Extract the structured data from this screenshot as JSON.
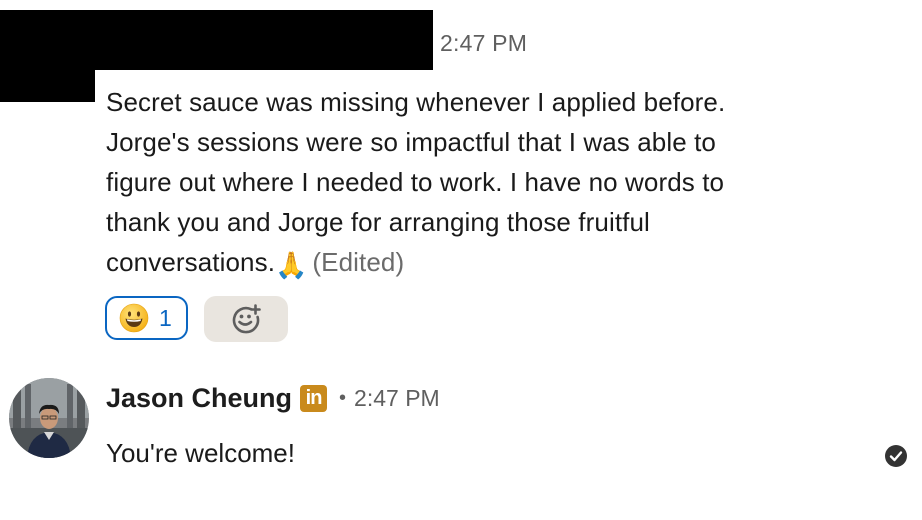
{
  "message_one": {
    "timestamp": "2:47 PM",
    "lines": [
      "Secret sauce was missing whenever I applied before.",
      "Jorge's sessions were so impactful that I was able to",
      "figure out where I needed to work. I have no words to",
      "thank you and Jorge for arranging those fruitful",
      "conversations."
    ],
    "emoji": "🙏",
    "edited_label": "(Edited)",
    "reactions": [
      {
        "emoji": "😀",
        "count": "1"
      }
    ],
    "add_reaction_icon": "add-emoji-icon"
  },
  "message_two": {
    "sender_name": "Jason Cheung",
    "badge_text": "in",
    "separator": "•",
    "timestamp": "2:47 PM",
    "text": "You're welcome!",
    "status_icon": "read-check-icon"
  },
  "colors": {
    "accent": "#0a66c2",
    "badge": "#c98a1c",
    "pill_bg": "#e9e5df",
    "meta_text": "#5f5f5f"
  }
}
